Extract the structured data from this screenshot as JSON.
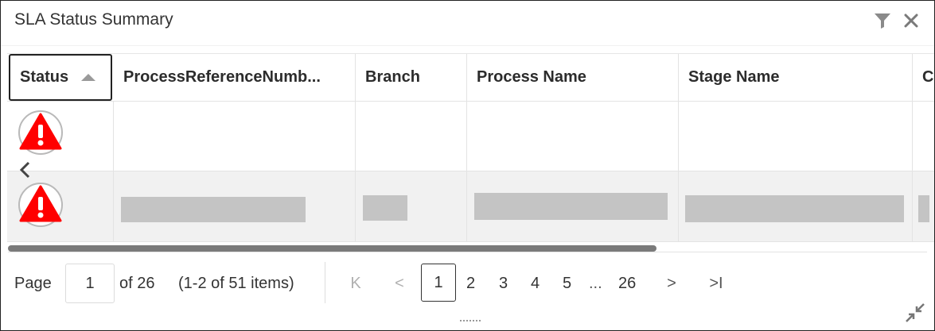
{
  "panel": {
    "title": "SLA Status Summary"
  },
  "header_icons": {
    "filter": "filter-icon",
    "close": "close-icon"
  },
  "columns": [
    {
      "label": "Status",
      "sorted": "ascending"
    },
    {
      "label": "ProcessReferenceNumb..."
    },
    {
      "label": "Branch"
    },
    {
      "label": "Process Name"
    },
    {
      "label": "Stage Name"
    },
    {
      "label": "C"
    }
  ],
  "rows": [
    {
      "status": "warning-icon",
      "redacted": false
    },
    {
      "status": "warning-icon",
      "redacted": true
    }
  ],
  "pager": {
    "page_label": "Page",
    "current_page": "1",
    "of_total": "of 26",
    "items_info": "(1-2 of 51 items)",
    "pages": [
      "1",
      "2",
      "3",
      "4",
      "5"
    ],
    "ellipsis": "...",
    "last_page": "26",
    "first_symbol": "K",
    "prev_symbol": "<",
    "next_symbol": ">",
    "last_symbol": ">I"
  },
  "colors": {
    "warning_red": "#ff0000",
    "redaction_gray": "#c4c4c4",
    "scrollbar": "#7a7a7a"
  }
}
